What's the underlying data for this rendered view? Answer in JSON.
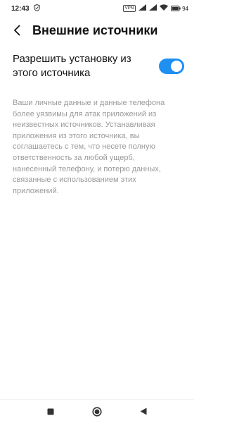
{
  "status_bar": {
    "time": "12:43",
    "vpn_label": "VPN",
    "battery_level": "94",
    "icons": [
      "shield-icon",
      "vpn-badge",
      "signal-icon",
      "signal-icon",
      "wifi-icon",
      "battery-icon"
    ]
  },
  "header": {
    "title": "Внешние источники",
    "back_icon": "back-arrow-icon"
  },
  "setting": {
    "label": "Разрешить установку из этого источника",
    "enabled": true,
    "accent_color": "#1f8ff2"
  },
  "description": "Ваши личные данные и данные телефона более уязвимы для атак приложений из неизвестных источников. Устанавливая приложения из этого источника, вы соглашаетесь с тем, что несете полную ответственность за любой ущерб, нанесенный телефону, и потерю данных, связанные с использованием этих приложений.",
  "nav_bar": {
    "buttons": [
      "recents-square-icon",
      "home-circle-icon",
      "back-triangle-icon"
    ]
  }
}
